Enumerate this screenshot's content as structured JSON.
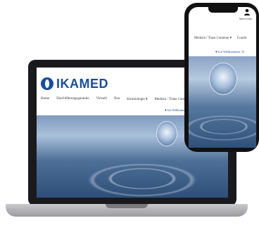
{
  "laptop": {
    "logo": "IKAMED",
    "nav": [
      "Home",
      "Durchführungsgarantie",
      "Virtuell",
      "Neu",
      "Kinesiologie ▾",
      "Medizin / Trans Commun ▾"
    ],
    "welcome": "Ich Willkommen"
  },
  "phone": {
    "time": "",
    "user_name": "Mein Konto",
    "nav": [
      "Medizin / Trans Commun ▾",
      "Coachi"
    ],
    "welcome": "Ich Willkommen, Vi"
  }
}
